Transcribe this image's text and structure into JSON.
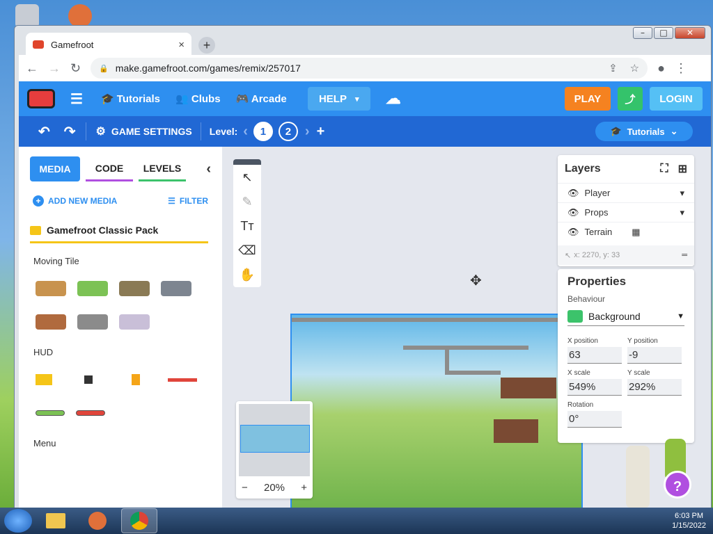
{
  "window": {
    "min": "–",
    "max": "□",
    "close": "✕"
  },
  "browser": {
    "tab_title": "Gamefroot",
    "tab_close": "×",
    "new_tab": "+",
    "url": "make.gamefroot.com/games/remix/257017",
    "lock": "🔒",
    "share_icon": "⇪",
    "star": "☆",
    "profile": "●",
    "menu": "⋮",
    "back": "←",
    "forward": "→",
    "reload": "↻"
  },
  "topnav": {
    "menu": "☰",
    "tutorials": "Tutorials",
    "clubs": "Clubs",
    "arcade": "Arcade",
    "help": "HELP",
    "help_caret": "▾",
    "cloud": "☁",
    "play": "PLAY",
    "share": "⤴",
    "login": "LOGIN",
    "colors": {
      "bar": "#2e8ff0",
      "play": "#f58220",
      "share": "#34c36b",
      "login": "#55c0f5",
      "help": "#4aa8f0"
    }
  },
  "subnav": {
    "undo": "↶",
    "redo": "↷",
    "settings": "GAME SETTINGS",
    "level_label": "Level:",
    "levels": [
      "1",
      "2"
    ],
    "prev": "‹",
    "next": "›",
    "add": "+",
    "tutorials": "Tutorials",
    "tutorials_caret": "⌄"
  },
  "left": {
    "tabs": [
      "MEDIA",
      "CODE",
      "LEVELS"
    ],
    "collapse": "‹",
    "add_media": "ADD NEW MEDIA",
    "filter": "FILTER",
    "pack": "Gamefroot Classic Pack",
    "sections": [
      "Moving Tile",
      "HUD",
      "Menu"
    ]
  },
  "tools": [
    "↖",
    "✎",
    "Tт",
    "⌫",
    "✋"
  ],
  "mini": {
    "zoom": "20%",
    "minus": "−",
    "plus": "+"
  },
  "layers": {
    "title": "Layers",
    "items": [
      "Player",
      "Props",
      "Terrain"
    ],
    "coords": "x: 2270, y: 33"
  },
  "props": {
    "title": "Properties",
    "behaviour_label": "Behaviour",
    "behaviour": "Background",
    "x_label": "X position",
    "x": "63",
    "y_label": "Y position",
    "y": "-9",
    "xs_label": "X scale",
    "xs": "549%",
    "ys_label": "Y scale",
    "ys": "292%",
    "rot_label": "Rotation",
    "rot": "0°"
  },
  "help_fab": "?",
  "taskbar": {
    "time": "6:03 PM",
    "date": "1/15/2022"
  }
}
